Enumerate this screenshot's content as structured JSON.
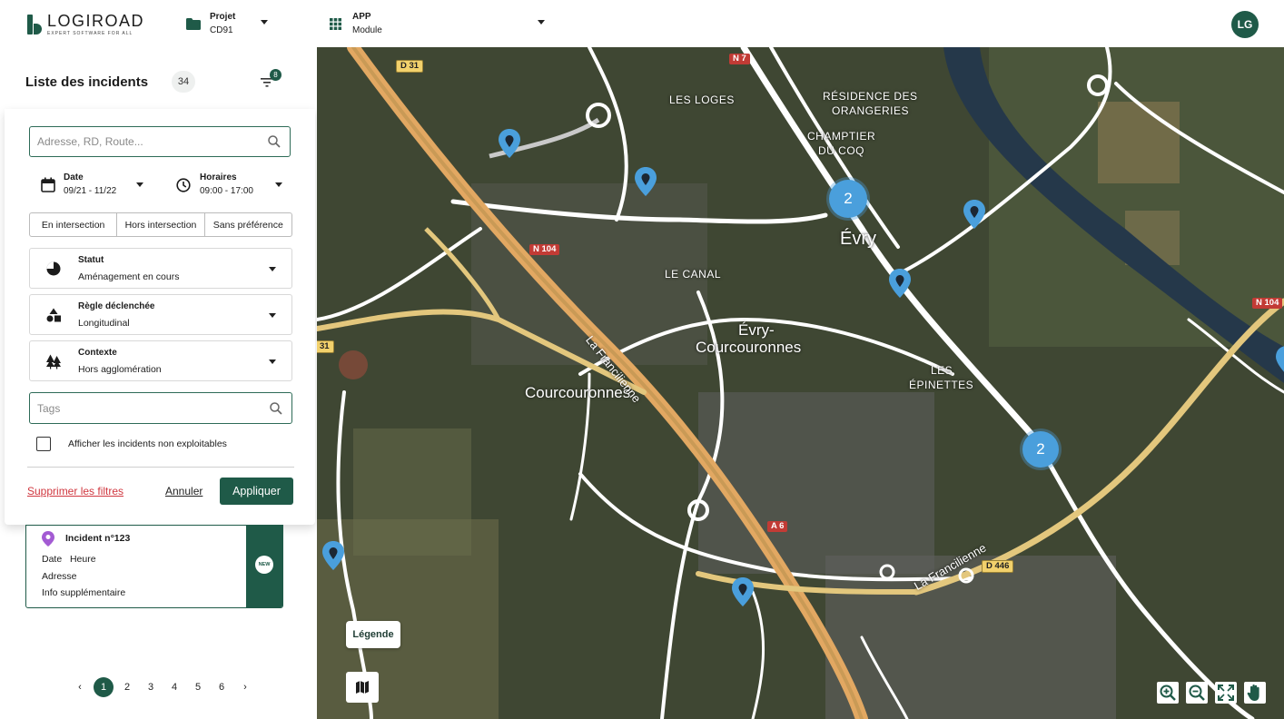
{
  "app": {
    "logo_name": "LOGIROAD",
    "logo_tagline": "EXPERT SOFTWARE FOR ALL",
    "brand_color": "#1f5a48"
  },
  "header": {
    "project_label": "Projet",
    "project_value": "CD91",
    "app_label": "APP",
    "app_value": "Module",
    "avatar_initials": "LG"
  },
  "panel": {
    "title": "Liste des incidents",
    "count": "34",
    "filter_count": "8"
  },
  "filters": {
    "search_placeholder": "Adresse, RD, Route...",
    "date_label": "Date",
    "date_value": "09/21 - 11/22",
    "hours_label": "Horaires",
    "hours_value": "09:00 - 17:00",
    "segments": [
      "En intersection",
      "Hors intersection",
      "Sans préférence"
    ],
    "status_label": "Statut",
    "status_value": "Aménagement en cours",
    "rule_label": "Règle déclenchée",
    "rule_value": "Longitudinal",
    "context_label": "Contexte",
    "context_value": "Hors agglomération",
    "tags_placeholder": "Tags",
    "checkbox_label": "Afficher les incidents non exploitables",
    "clear_label": "Supprimer les filtres",
    "cancel_label": "Annuler",
    "apply_label": "Appliquer"
  },
  "incident": {
    "title": "Incident n°123",
    "date_label": "Date",
    "time_label": "Heure",
    "address_label": "Adresse",
    "info_label": "Info supplémentaire",
    "badge": "NEW"
  },
  "pagination": {
    "pages": [
      "1",
      "2",
      "3",
      "4",
      "5",
      "6"
    ],
    "current": "1",
    "prev": "‹",
    "next": "›"
  },
  "map": {
    "places": {
      "loges": "LES LOGES",
      "residence": "RÉSIDENCE DES",
      "orangeries": "ORANGERIES",
      "champtier": "CHAMPTIER",
      "ducoq": "DU COQ",
      "evry": "Évry",
      "canal": "LE CANAL",
      "evry2": "Évry-",
      "courcouronnes_city": "Courcouronnes",
      "courcouronnes": "Courcouronnes",
      "les": "LES",
      "epinettes": "ÉPINETTES",
      "francilienne": "La Francilienne",
      "francilienne2": "La Francilienne"
    },
    "roads": {
      "d31": "D 31",
      "n7": "N 7",
      "n104": "N 104",
      "n104b": "N 104",
      "d31b": "31",
      "a6": "A 6",
      "d446": "D 446"
    },
    "clusters": [
      "2",
      "2"
    ],
    "legend_label": "Légende",
    "cluster_color": "#4a9fdc"
  }
}
